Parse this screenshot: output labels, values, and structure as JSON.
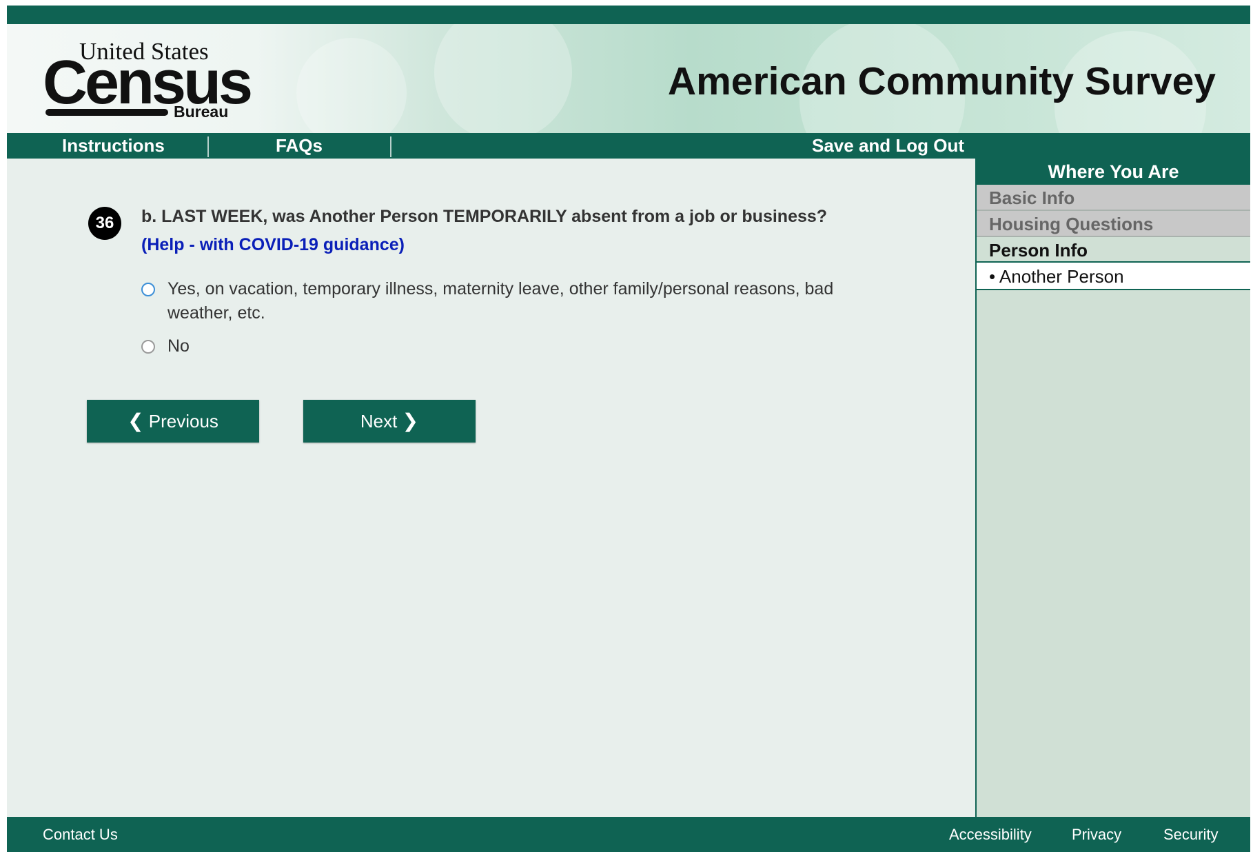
{
  "header": {
    "logo": {
      "united_states": "United States",
      "census": "Census",
      "bureau": "Bureau"
    },
    "title": "American Community Survey"
  },
  "nav": {
    "instructions": "Instructions",
    "faqs": "FAQs",
    "save_logout": "Save and Log Out"
  },
  "question": {
    "number": "36",
    "text": "b. LAST WEEK, was Another Person TEMPORARILY absent from a job or business?",
    "help_link": "(Help - with COVID-19 guidance)",
    "options": [
      {
        "label": "Yes, on vacation, temporary illness, maternity leave, other family/personal reasons, bad weather, etc.",
        "selected": false
      },
      {
        "label": "No",
        "selected": false
      }
    ]
  },
  "buttons": {
    "previous": "Previous",
    "next": "Next"
  },
  "sidebar": {
    "heading": "Where You Are",
    "items": [
      "Basic Info",
      "Housing Questions",
      "Person Info"
    ],
    "current_person": "• Another Person"
  },
  "footer": {
    "contact": "Contact Us",
    "accessibility": "Accessibility",
    "privacy": "Privacy",
    "security": "Security"
  },
  "colors": {
    "primary_green": "#0f6353",
    "help_link_blue": "#0a1fb8",
    "content_bg": "#e8efec",
    "sidebar_bg": "#d0e0d5"
  }
}
